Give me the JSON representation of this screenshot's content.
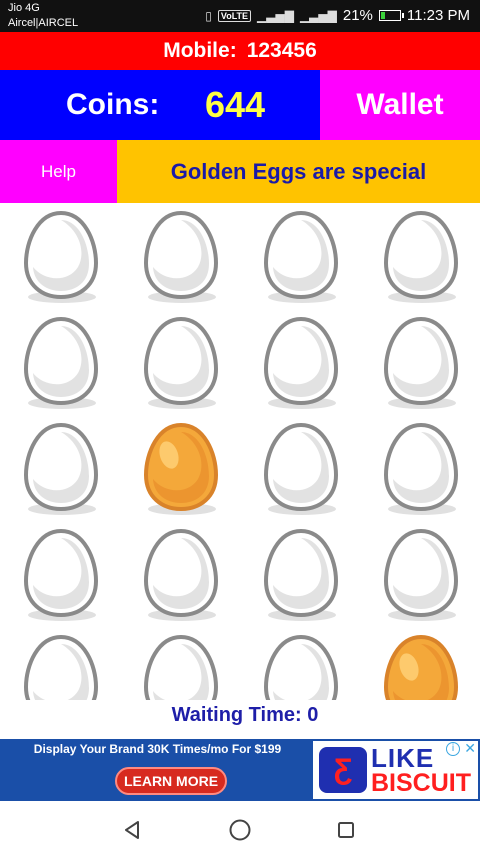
{
  "status_bar": {
    "carrier_line1": "Jio 4G",
    "carrier_line2": "Aircel|AIRCEL",
    "volte": "VoLTE",
    "battery_percent": "21%",
    "battery_level": 0.21,
    "time": "11:23 PM"
  },
  "header": {
    "mobile_label": "Mobile:",
    "mobile_number": "123456",
    "coins_label": "Coins:",
    "coins_value": "644",
    "wallet_label": "Wallet",
    "help_label": "Help",
    "tip_text": "Golden Eggs are special"
  },
  "colors": {
    "mobile_bar": "#ff0000",
    "coins_bar": "#0000ff",
    "wallet": "#ff00ff",
    "help": "#ff00ff",
    "tip_bar": "#ffc300",
    "coins_value": "#ffff44",
    "golden_egg": "#f4a83a",
    "white_egg": "#ffffff"
  },
  "eggs": [
    [
      "white",
      "white",
      "white",
      "white"
    ],
    [
      "white",
      "white",
      "white",
      "white"
    ],
    [
      "white",
      "golden",
      "white",
      "white"
    ],
    [
      "white",
      "white",
      "white",
      "white"
    ],
    [
      "white",
      "white",
      "white",
      "golden"
    ]
  ],
  "waiting_text": "Waiting Time: 0",
  "ad": {
    "headline": "Display Your Brand  30K Times/mo  For $199",
    "button_label": "LEARN MORE",
    "brand_line1": "LIKE",
    "brand_line2": "BISCUIT",
    "logo_icon": "lb-logo-icon",
    "info_icon": "ad-info-icon",
    "close_icon": "ad-close-icon"
  },
  "nav": {
    "back_icon": "back-triangle-icon",
    "home_icon": "home-circle-icon",
    "recents_icon": "recents-square-icon"
  }
}
